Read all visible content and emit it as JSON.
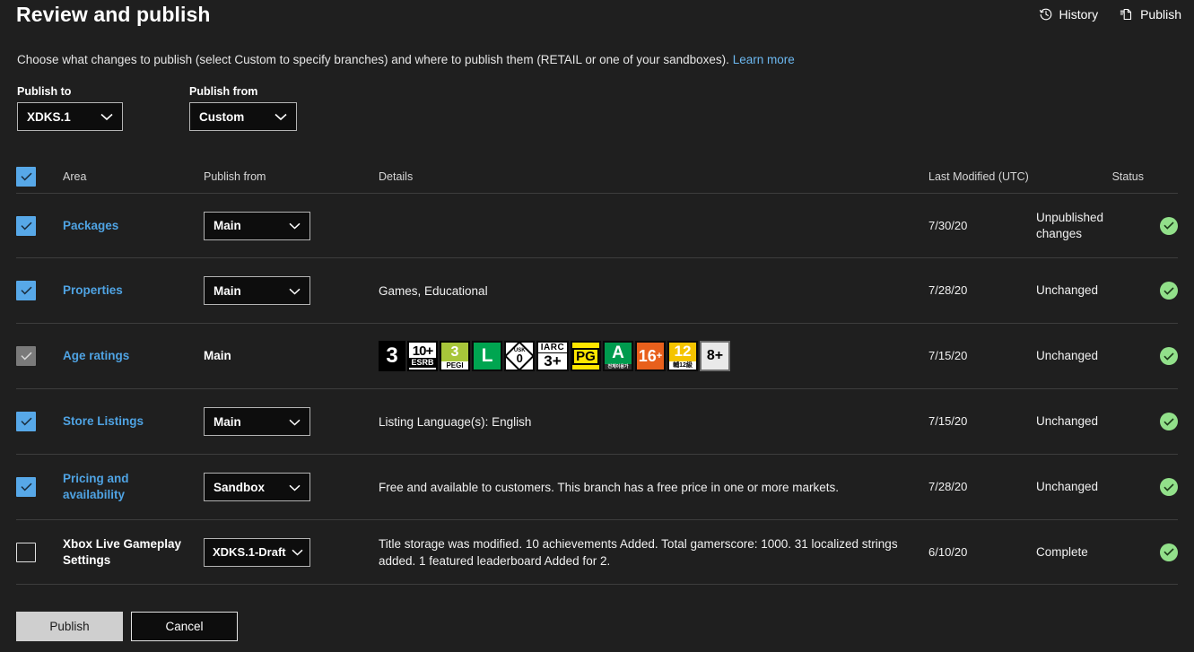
{
  "header": {
    "title": "Review and publish",
    "actions": [
      {
        "label": "History",
        "icon": "history-icon"
      },
      {
        "label": "Publish",
        "icon": "publish-page-icon"
      }
    ]
  },
  "subtitle": {
    "text": "Choose what changes to publish (select Custom to specify branches) and where to publish them (RETAIL or one of your sandboxes).",
    "link": "Learn more"
  },
  "selectors": {
    "publish_to": {
      "label": "Publish to",
      "value": "XDKS.1"
    },
    "publish_from": {
      "label": "Publish from",
      "value": "Custom"
    }
  },
  "table": {
    "headers": {
      "area": "Area",
      "publish_from": "Publish from",
      "details": "Details",
      "last_modified": "Last Modified (UTC)",
      "status": "Status"
    },
    "rows": [
      {
        "area": "Packages",
        "checkbox": "checked",
        "branch": "Main",
        "branch_type": "dropdown",
        "details": "",
        "last_modified": "7/30/20",
        "status": "Unpublished changes",
        "status_icon": "check-circle-icon"
      },
      {
        "area": "Properties",
        "checkbox": "checked",
        "branch": "Main",
        "branch_type": "dropdown",
        "details": "Games, Educational",
        "last_modified": "7/28/20",
        "status": "Unchanged",
        "status_icon": "check-circle-icon"
      },
      {
        "area": "Age ratings",
        "checkbox": "disabled",
        "branch": "Main",
        "branch_type": "text",
        "details": "",
        "details_type": "ratings",
        "last_modified": "7/15/20",
        "status": "Unchanged",
        "status_icon": "check-circle-icon"
      },
      {
        "area": "Store Listings",
        "checkbox": "checked",
        "branch": "Main",
        "branch_type": "dropdown",
        "details": "Listing Language(s): English",
        "last_modified": "7/15/20",
        "status": "Unchanged",
        "status_icon": "check-circle-icon"
      },
      {
        "area": "Pricing and availability",
        "checkbox": "checked",
        "branch": "Sandbox",
        "branch_type": "dropdown",
        "details": "Free and available to customers. This branch has a free price in one or more markets.",
        "last_modified": "7/28/20",
        "status": "Unchanged",
        "status_icon": "check-circle-icon"
      },
      {
        "area": "Xbox Live Gameplay Settings",
        "area_style": "plain",
        "checkbox": "empty",
        "branch": "XDKS.1-Draft",
        "branch_type": "dropdown",
        "details": "Title storage was modified. 10 achievements Added. Total gamerscore: 1000. 31 localized strings added. 1 featured leaderboard Added for 2.",
        "last_modified": "6/10/20",
        "status": "Complete",
        "status_icon": "check-circle-icon"
      }
    ]
  },
  "age_ratings": [
    {
      "name": "generic-3",
      "top": "3",
      "bottom": ""
    },
    {
      "name": "esrb-everyone-10",
      "top": "10+",
      "bottom": "ESRB"
    },
    {
      "name": "pegi-3",
      "top": "3",
      "bottom": "PEGI"
    },
    {
      "name": "classind-l",
      "top": "L",
      "bottom": ""
    },
    {
      "name": "usk-0",
      "top": "USK",
      "bottom": "0"
    },
    {
      "name": "iarc-3plus",
      "top": "IARC",
      "bottom": "3+"
    },
    {
      "name": "acb-pg",
      "top": "PG",
      "bottom": ""
    },
    {
      "name": "grac-all",
      "top": "A",
      "bottom": "전체이용가"
    },
    {
      "name": "russia-16plus",
      "top": "16",
      "bottom": "+"
    },
    {
      "name": "gsrr-12",
      "top": "12",
      "bottom": "輔12級"
    },
    {
      "name": "generic-8plus",
      "top": "",
      "bottom": "8+"
    }
  ],
  "footer": {
    "publish": "Publish",
    "cancel": "Cancel"
  },
  "colors": {
    "background": "#1f1f1f",
    "link": "#4fa3e3",
    "checkbox": "#57a8e8",
    "status_ok": "#92e08a",
    "divider": "#3d3d3d"
  }
}
